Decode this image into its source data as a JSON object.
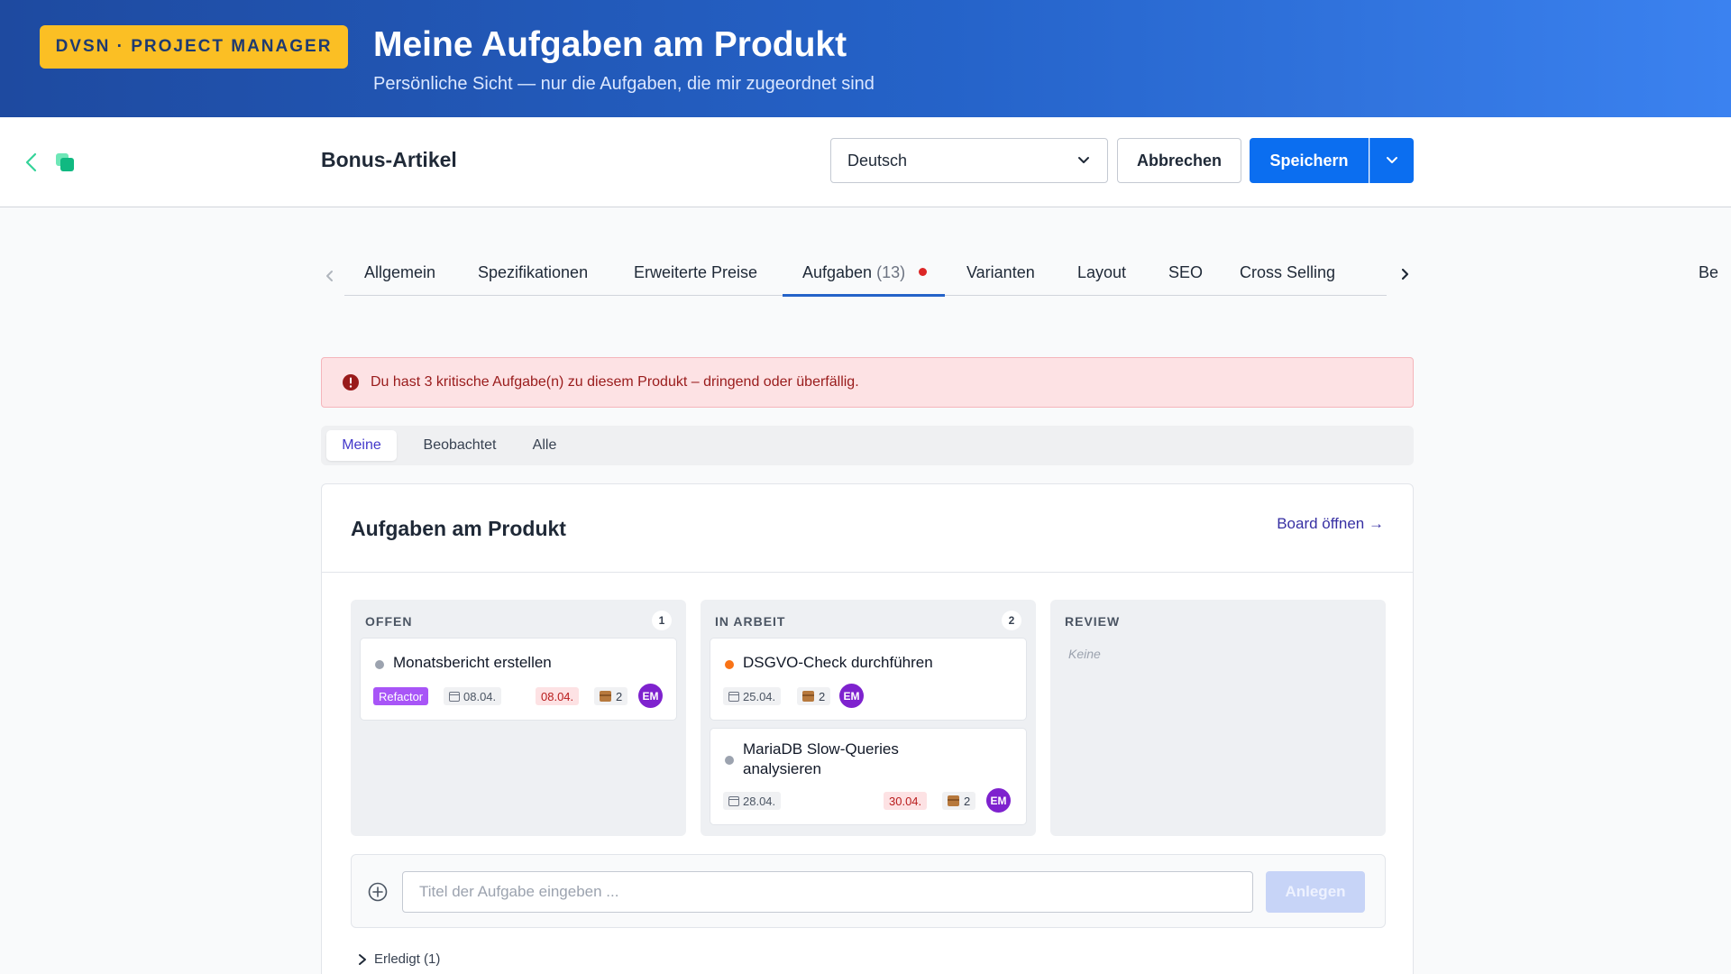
{
  "banner": {
    "badge": "DVSN · PROJECT MANAGER",
    "title": "Meine Aufgaben am Produkt",
    "subtitle": "Persönliche Sicht — nur die Aufgaben, die mir zugeordnet sind"
  },
  "topbar": {
    "product_title": "Bonus-Artikel",
    "language_selected": "Deutsch",
    "cancel_label": "Abbrechen",
    "save_label": "Speichern"
  },
  "tabs": {
    "items": [
      {
        "label": "Allgemein"
      },
      {
        "label": "Spezifikationen"
      },
      {
        "label": "Erweiterte Preise"
      },
      {
        "label": "Aufgaben",
        "count": "(13)",
        "active": true
      },
      {
        "label": "Varianten"
      },
      {
        "label": "Layout"
      },
      {
        "label": "SEO"
      },
      {
        "label": "Cross Selling"
      },
      {
        "label": "Be"
      }
    ]
  },
  "alert": {
    "text": "Du hast 3 kritische Aufgabe(n) zu diesem Produkt – dringend oder überfällig."
  },
  "filter": {
    "items": [
      "Meine",
      "Beobachtet",
      "Alle"
    ],
    "active": "Meine"
  },
  "card": {
    "title": "Aufgaben am Produkt",
    "board_link": "Board öffnen →"
  },
  "columns": [
    {
      "title": "OFFEN",
      "count": "1",
      "tasks": [
        {
          "title": "Monatsbericht erstellen",
          "tag": "Refactor",
          "date": "08.04.",
          "due": "08.04.",
          "items": "2",
          "assignee": "EM"
        }
      ]
    },
    {
      "title": "IN ARBEIT",
      "count": "2",
      "tasks": [
        {
          "title": "DSGVO-Check durchführen",
          "date": "25.04.",
          "items": "2",
          "assignee": "EM"
        },
        {
          "title": "MariaDB Slow-Queries analysieren",
          "date": "28.04.",
          "due": "30.04.",
          "items": "2",
          "assignee": "EM"
        }
      ]
    },
    {
      "title": "REVIEW",
      "empty_text": "Keine"
    }
  ],
  "new_task": {
    "placeholder": "Titel der Aufgabe eingeben ...",
    "create_label": "Anlegen"
  },
  "done_toggle": "Erledigt (1)",
  "colors": {
    "banner_start": "#1e4aa0",
    "banner_end": "#3b82f0",
    "badge": "#fbbf24",
    "primary": "#0b6ef0",
    "status_open": "#9ca3af",
    "status_in_progress": "#f97316",
    "avatar": "#7e22ce",
    "tag": "#a855f7"
  }
}
